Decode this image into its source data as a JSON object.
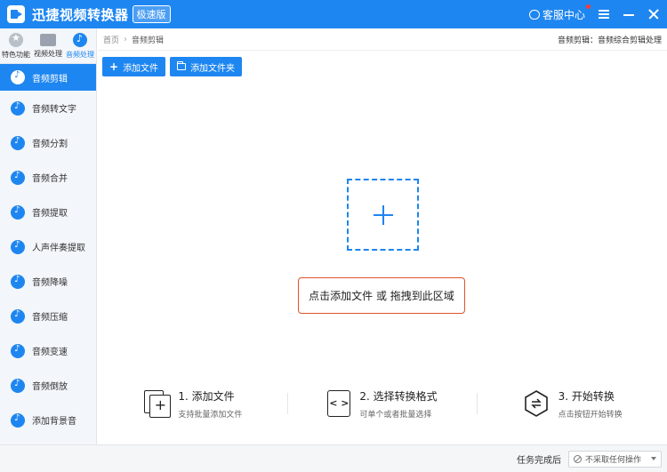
{
  "titlebar": {
    "title": "迅捷视频转换器",
    "edition": "极速版",
    "service": "客服中心"
  },
  "sidebar": {
    "tabs": [
      {
        "label": "特色功能",
        "icon": "star-icon"
      },
      {
        "label": "视频处理",
        "icon": "film-icon"
      },
      {
        "label": "音频处理",
        "icon": "music-note-icon",
        "active": true
      }
    ],
    "items": [
      {
        "label": "音频剪辑",
        "active": true
      },
      {
        "label": "音频转文字"
      },
      {
        "label": "音频分割"
      },
      {
        "label": "音频合并"
      },
      {
        "label": "音频提取"
      },
      {
        "label": "人声伴奏提取"
      },
      {
        "label": "音频降噪"
      },
      {
        "label": "音频压缩"
      },
      {
        "label": "音频变速"
      },
      {
        "label": "音频倒放"
      },
      {
        "label": "添加背景音"
      }
    ]
  },
  "main": {
    "breadcrumb": {
      "home": "首页",
      "current": "音频剪辑"
    },
    "description": "音频剪辑：音频综合剪辑处理",
    "toolbar": {
      "add_file": "添加文件",
      "add_folder": "添加文件夹"
    },
    "drop_hint": "点击添加文件 或 拖拽到此区域",
    "steps": [
      {
        "title": "1. 添加文件",
        "subtitle": "支持批量添加文件"
      },
      {
        "title": "2. 选择转换格式",
        "subtitle": "可单个或者批量选择"
      },
      {
        "title": "3. 开始转换",
        "subtitle": "点击按钮开始转换"
      }
    ]
  },
  "statusbar": {
    "label": "任务完成后",
    "after_action": "不采取任何操作"
  },
  "colors": {
    "accent": "#1e86f0",
    "highlight_border": "#e0532a"
  }
}
